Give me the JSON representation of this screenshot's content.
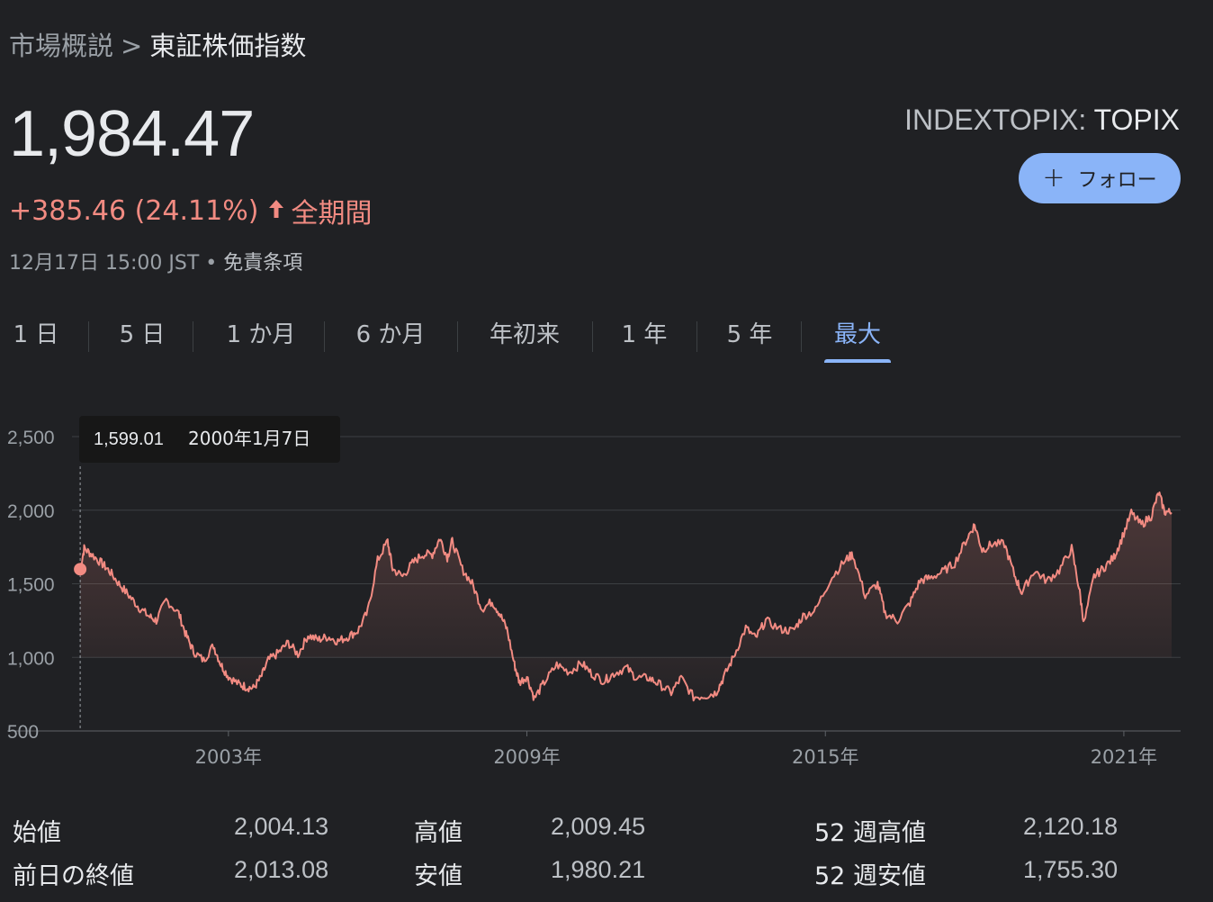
{
  "breadcrumb": {
    "parent": "市場概説",
    "separator": ">",
    "current": "東証株価指数"
  },
  "quote": {
    "price": "1,984.47",
    "change": "+385.46 (24.11%)",
    "period": "全期間",
    "timestamp": "12月17日 15:00 JST",
    "bullet": "•",
    "disclaimer": "免責条項",
    "exchange": "INDEXTOPIX:",
    "symbol": "TOPIX"
  },
  "follow_button": {
    "label": "フォロー",
    "icon": "plus-icon",
    "color": "#8ab4f8"
  },
  "tabs": [
    {
      "label": "1 日",
      "active": false
    },
    {
      "label": "5 日",
      "active": false
    },
    {
      "label": "1 か月",
      "active": false
    },
    {
      "label": "6 か月",
      "active": false
    },
    {
      "label": "年初来",
      "active": false
    },
    {
      "label": "1 年",
      "active": false
    },
    {
      "label": "5 年",
      "active": false
    },
    {
      "label": "最大",
      "active": true
    }
  ],
  "colors": {
    "line": "#f28b82",
    "accent": "#8ab4f8",
    "background": "#202124"
  },
  "chart_data": {
    "type": "area",
    "y_ticks": [
      "2,500",
      "2,000",
      "1,500",
      "1,000",
      "500"
    ],
    "y_tick_values": [
      2500,
      2000,
      1500,
      1000,
      500
    ],
    "ylim": [
      500,
      2500
    ],
    "x_ticks": [
      "2003年",
      "2009年",
      "2015年",
      "2021年"
    ],
    "x_tick_values": [
      2003,
      2009,
      2015,
      2021
    ],
    "xlim": [
      2000.0,
      2021.96
    ],
    "grid": true,
    "tooltip": {
      "value": "1,599.01",
      "date": "2000年1月7日"
    },
    "series": [
      {
        "points": [
          [
            2000.02,
            1599
          ],
          [
            2000.1,
            1740
          ],
          [
            2000.25,
            1700
          ],
          [
            2000.45,
            1640
          ],
          [
            2000.6,
            1590
          ],
          [
            2000.8,
            1500
          ],
          [
            2001.0,
            1420
          ],
          [
            2001.2,
            1340
          ],
          [
            2001.4,
            1280
          ],
          [
            2001.55,
            1250
          ],
          [
            2001.75,
            1390
          ],
          [
            2002.0,
            1300
          ],
          [
            2002.15,
            1150
          ],
          [
            2002.3,
            1040
          ],
          [
            2002.5,
            980
          ],
          [
            2002.7,
            1080
          ],
          [
            2002.85,
            950
          ],
          [
            2003.0,
            870
          ],
          [
            2003.2,
            820
          ],
          [
            2003.35,
            800
          ],
          [
            2003.5,
            790
          ],
          [
            2003.65,
            860
          ],
          [
            2003.8,
            980
          ],
          [
            2004.0,
            1030
          ],
          [
            2004.2,
            1100
          ],
          [
            2004.4,
            1020
          ],
          [
            2004.6,
            1150
          ],
          [
            2004.8,
            1120
          ],
          [
            2005.0,
            1140
          ],
          [
            2005.2,
            1110
          ],
          [
            2005.4,
            1140
          ],
          [
            2005.6,
            1180
          ],
          [
            2005.8,
            1310
          ],
          [
            2006.0,
            1660
          ],
          [
            2006.2,
            1790
          ],
          [
            2006.3,
            1600
          ],
          [
            2006.5,
            1550
          ],
          [
            2006.7,
            1640
          ],
          [
            2006.9,
            1700
          ],
          [
            2007.1,
            1700
          ],
          [
            2007.25,
            1810
          ],
          [
            2007.4,
            1680
          ],
          [
            2007.5,
            1790
          ],
          [
            2007.7,
            1600
          ],
          [
            2007.9,
            1500
          ],
          [
            2008.1,
            1330
          ],
          [
            2008.3,
            1380
          ],
          [
            2008.45,
            1300
          ],
          [
            2008.6,
            1190
          ],
          [
            2008.75,
            950
          ],
          [
            2008.85,
            830
          ],
          [
            2009.0,
            870
          ],
          [
            2009.15,
            720
          ],
          [
            2009.35,
            830
          ],
          [
            2009.6,
            950
          ],
          [
            2009.85,
            900
          ],
          [
            2010.1,
            960
          ],
          [
            2010.3,
            890
          ],
          [
            2010.55,
            840
          ],
          [
            2010.75,
            890
          ],
          [
            2011.0,
            930
          ],
          [
            2011.2,
            860
          ],
          [
            2011.45,
            860
          ],
          [
            2011.65,
            820
          ],
          [
            2011.9,
            760
          ],
          [
            2012.1,
            860
          ],
          [
            2012.35,
            730
          ],
          [
            2012.6,
            740
          ],
          [
            2012.8,
            760
          ],
          [
            2012.95,
            860
          ],
          [
            2013.15,
            1000
          ],
          [
            2013.4,
            1200
          ],
          [
            2013.6,
            1130
          ],
          [
            2013.8,
            1250
          ],
          [
            2014.1,
            1190
          ],
          [
            2014.35,
            1180
          ],
          [
            2014.55,
            1280
          ],
          [
            2014.8,
            1320
          ],
          [
            2015.1,
            1530
          ],
          [
            2015.4,
            1660
          ],
          [
            2015.55,
            1700
          ],
          [
            2015.8,
            1420
          ],
          [
            2016.05,
            1500
          ],
          [
            2016.2,
            1300
          ],
          [
            2016.45,
            1250
          ],
          [
            2016.7,
            1370
          ],
          [
            2016.9,
            1520
          ],
          [
            2017.1,
            1540
          ],
          [
            2017.35,
            1580
          ],
          [
            2017.6,
            1640
          ],
          [
            2017.85,
            1810
          ],
          [
            2018.0,
            1900
          ],
          [
            2018.15,
            1730
          ],
          [
            2018.35,
            1770
          ],
          [
            2018.6,
            1770
          ],
          [
            2018.8,
            1560
          ],
          [
            2018.95,
            1440
          ],
          [
            2019.2,
            1590
          ],
          [
            2019.45,
            1520
          ],
          [
            2019.7,
            1590
          ],
          [
            2019.95,
            1740
          ],
          [
            2020.1,
            1470
          ],
          [
            2020.2,
            1230
          ],
          [
            2020.4,
            1550
          ],
          [
            2020.6,
            1610
          ],
          [
            2020.8,
            1680
          ],
          [
            2020.95,
            1800
          ],
          [
            2021.15,
            1980
          ],
          [
            2021.35,
            1900
          ],
          [
            2021.55,
            1960
          ],
          [
            2021.7,
            2118
          ],
          [
            2021.82,
            1990
          ],
          [
            2021.96,
            1984
          ]
        ]
      }
    ]
  },
  "stats": [
    {
      "label": "始値",
      "value": "2,004.13"
    },
    {
      "label": "高値",
      "value": "2,009.45"
    },
    {
      "label": "52 週高値",
      "value": "2,120.18"
    },
    {
      "label": "前日の終値",
      "value": "2,013.08"
    },
    {
      "label": "安値",
      "value": "1,980.21"
    },
    {
      "label": "52 週安値",
      "value": "1,755.30"
    }
  ]
}
